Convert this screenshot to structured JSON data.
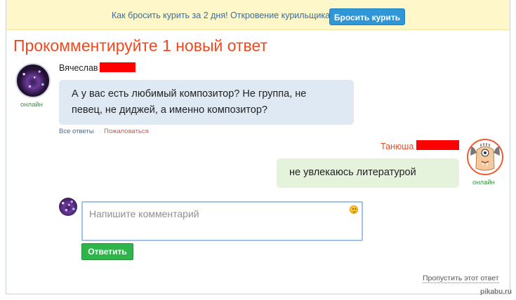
{
  "promo": {
    "text": "Как бросить курить за 2 дня! Откровение курильщика!",
    "button_label": "Бросить курить"
  },
  "title": "Прокомментируйте 1 новый ответ",
  "question": {
    "author": "Вячеслав",
    "status": "онлайн",
    "text_line1": "А у вас есть любимый композитор? Не группа, не",
    "text_line2": "певец, не диджей, а именно композитор?",
    "links": {
      "all_answers": "Все ответы",
      "separator": "·",
      "report": "Пожаловаться"
    }
  },
  "answer": {
    "author": "Танюша",
    "status": "онлайн",
    "text": "не увлекаюсь литературой"
  },
  "comment_form": {
    "placeholder": "Напишите комментарий",
    "reply_label": "Ответить"
  },
  "skip_label": "Пропустить этот ответ",
  "watermark": "pikabu.ru",
  "colors": {
    "accent": "#ef4a1f",
    "online": "#2f9b3c",
    "reply_button": "#2fb64b",
    "promo_button": "#2f96d7"
  }
}
